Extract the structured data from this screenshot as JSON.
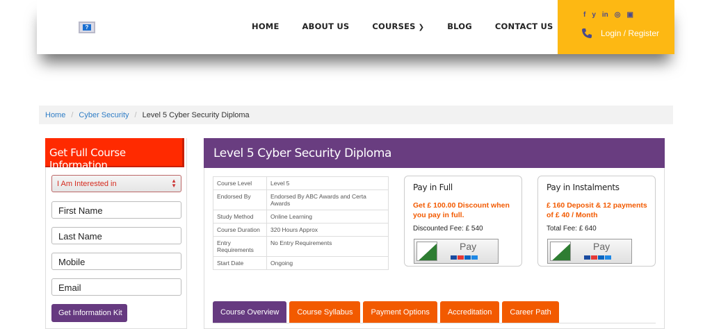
{
  "header": {
    "logo_glyph": "?",
    "nav": [
      {
        "label": "HOME"
      },
      {
        "label": "ABOUT US"
      },
      {
        "label": "COURSES"
      },
      {
        "label": "BLOG"
      },
      {
        "label": "CONTACT US"
      }
    ],
    "socials": [
      {
        "icon": "facebook-icon",
        "glyph": "f"
      },
      {
        "icon": "twitter-icon",
        "glyph": "y"
      },
      {
        "icon": "linkedin-icon",
        "glyph": "in"
      },
      {
        "icon": "instagram-icon",
        "glyph": "◎"
      },
      {
        "icon": "youtube-icon",
        "glyph": "▣"
      }
    ],
    "login_label": "Login / Register",
    "accent_color": "#fdb813"
  },
  "breadcrumb": {
    "home": "Home",
    "category": "Cyber Security",
    "current": "Level 5 Cyber Security Diploma"
  },
  "form": {
    "title": "Get Full Course Information",
    "select_value": "I Am Interested in",
    "first_name_placeholder": "First Name",
    "last_name_placeholder": "Last Name",
    "mobile_placeholder": "Mobile",
    "email_placeholder": "Email",
    "submit_label": "Get Information Kit",
    "title_color": "#ff2a00"
  },
  "course": {
    "title": "Level 5 Cyber Security Diploma",
    "title_color": "#693d80",
    "details": [
      {
        "key": "Course Level",
        "value": "Level 5"
      },
      {
        "key": "Endorsed By",
        "value": "Endorsed By ABC Awards and Certa Awards"
      },
      {
        "key": "Study Method",
        "value": "Online Learning"
      },
      {
        "key": "Course Duration",
        "value": "320 Hours Approx"
      },
      {
        "key": "Entry Requirements",
        "value": "No Entry Requirements"
      },
      {
        "key": "Start Date",
        "value": "Ongoing"
      }
    ],
    "pay_full": {
      "title": "Pay in Full",
      "offer": "Get £ 100.00 Discount when you pay in full.",
      "fee": "Discounted Fee: £ 540",
      "button": "Pay"
    },
    "pay_instalments": {
      "title": "Pay in Instalments",
      "offer": "£ 160 Deposit & 12 payments of £ 40 / Month",
      "fee": "Total Fee: £ 640",
      "button": "Pay"
    },
    "tabs": [
      {
        "label": "Course Overview",
        "active": true
      },
      {
        "label": "Course Syllabus",
        "active": false
      },
      {
        "label": "Payment Options",
        "active": false
      },
      {
        "label": "Accreditation",
        "active": false
      },
      {
        "label": "Career Path",
        "active": false
      }
    ],
    "tab_color": "#f25a00",
    "active_tab_color": "#663a80"
  }
}
